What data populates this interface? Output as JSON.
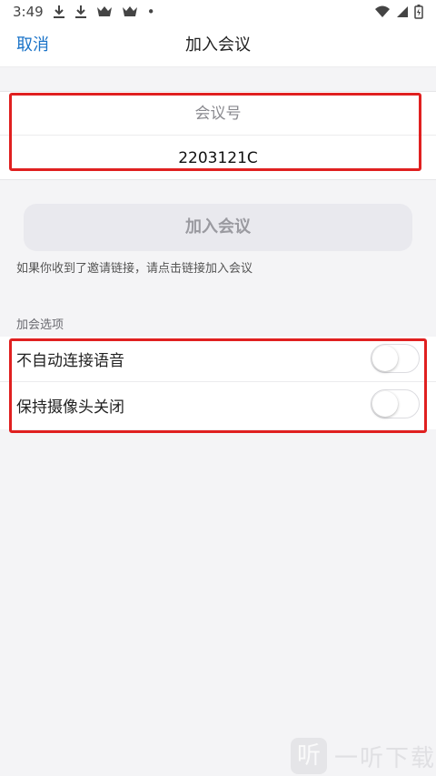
{
  "status_bar": {
    "time": "3:49",
    "dot": "•"
  },
  "nav": {
    "cancel_label": "取消",
    "title": "加入会议"
  },
  "meeting_input": {
    "label": "会议号",
    "value": "2203121C"
  },
  "join_button_label": "加入会议",
  "hint_text": "如果你收到了邀请链接，请点击链接加入会议",
  "options": {
    "section_title": "加会选项",
    "items": [
      {
        "label": "不自动连接语音",
        "enabled": false
      },
      {
        "label": "保持摄像头关闭",
        "enabled": false
      }
    ]
  },
  "watermark": {
    "logo_glyph": "听",
    "text": "一听下载"
  },
  "colors": {
    "accent": "#1a73c8",
    "highlight_border": "#e02020",
    "disabled_button_bg": "#e9e9ee",
    "disabled_button_text": "#9a9aa0"
  }
}
